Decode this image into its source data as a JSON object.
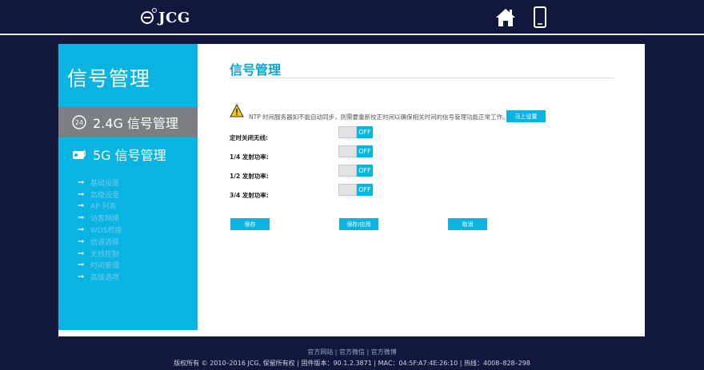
{
  "header": {
    "brand": "JCG",
    "home_icon": "home-icon",
    "mobile_icon": "mobile-phone-icon"
  },
  "sidebar": {
    "title": "信号管理",
    "items": [
      {
        "label": "2.4G 信号管理",
        "icon": "2.4g-icon",
        "active": true
      },
      {
        "label": "5G 信号管理",
        "icon": "5g-icon",
        "active": false
      }
    ],
    "subitems": [
      "基础设置",
      "高级设置",
      "AP 列表",
      "访客网络",
      "WDS桥接",
      "信道选择",
      "无线控制",
      "时间管理",
      "高级选项"
    ]
  },
  "main": {
    "title": "信号管理",
    "notice": "NTP 时间服务器如不能自动同步，则需要重新校正时间以确保相关时间的信号管理功能正常工作。",
    "set_now": "马上设置",
    "rows": [
      {
        "label": "定时关闭无线:",
        "state": "OFF"
      },
      {
        "label": "1/4 发射功率:",
        "state": "OFF"
      },
      {
        "label": "1/2 发射功率:",
        "state": "OFF"
      },
      {
        "label": "3/4 发射功率:",
        "state": "OFF"
      }
    ],
    "buttons": {
      "save": "保存",
      "save_apply": "保存/应用",
      "cancel": "取消"
    }
  },
  "footer": {
    "links": "官方网站 | 官方微信 | 官方微博",
    "copyright": "版权所有 © 2010–2016 JCG, 保留所有权 | 固件版本：90.1.2.3871 | MAC：04:5F:A7:4E:26:10 | 热线：4008–828–298"
  },
  "colors": {
    "accent": "#0ab4e2",
    "background": "#12183d",
    "active_item": "#7b7e82"
  }
}
